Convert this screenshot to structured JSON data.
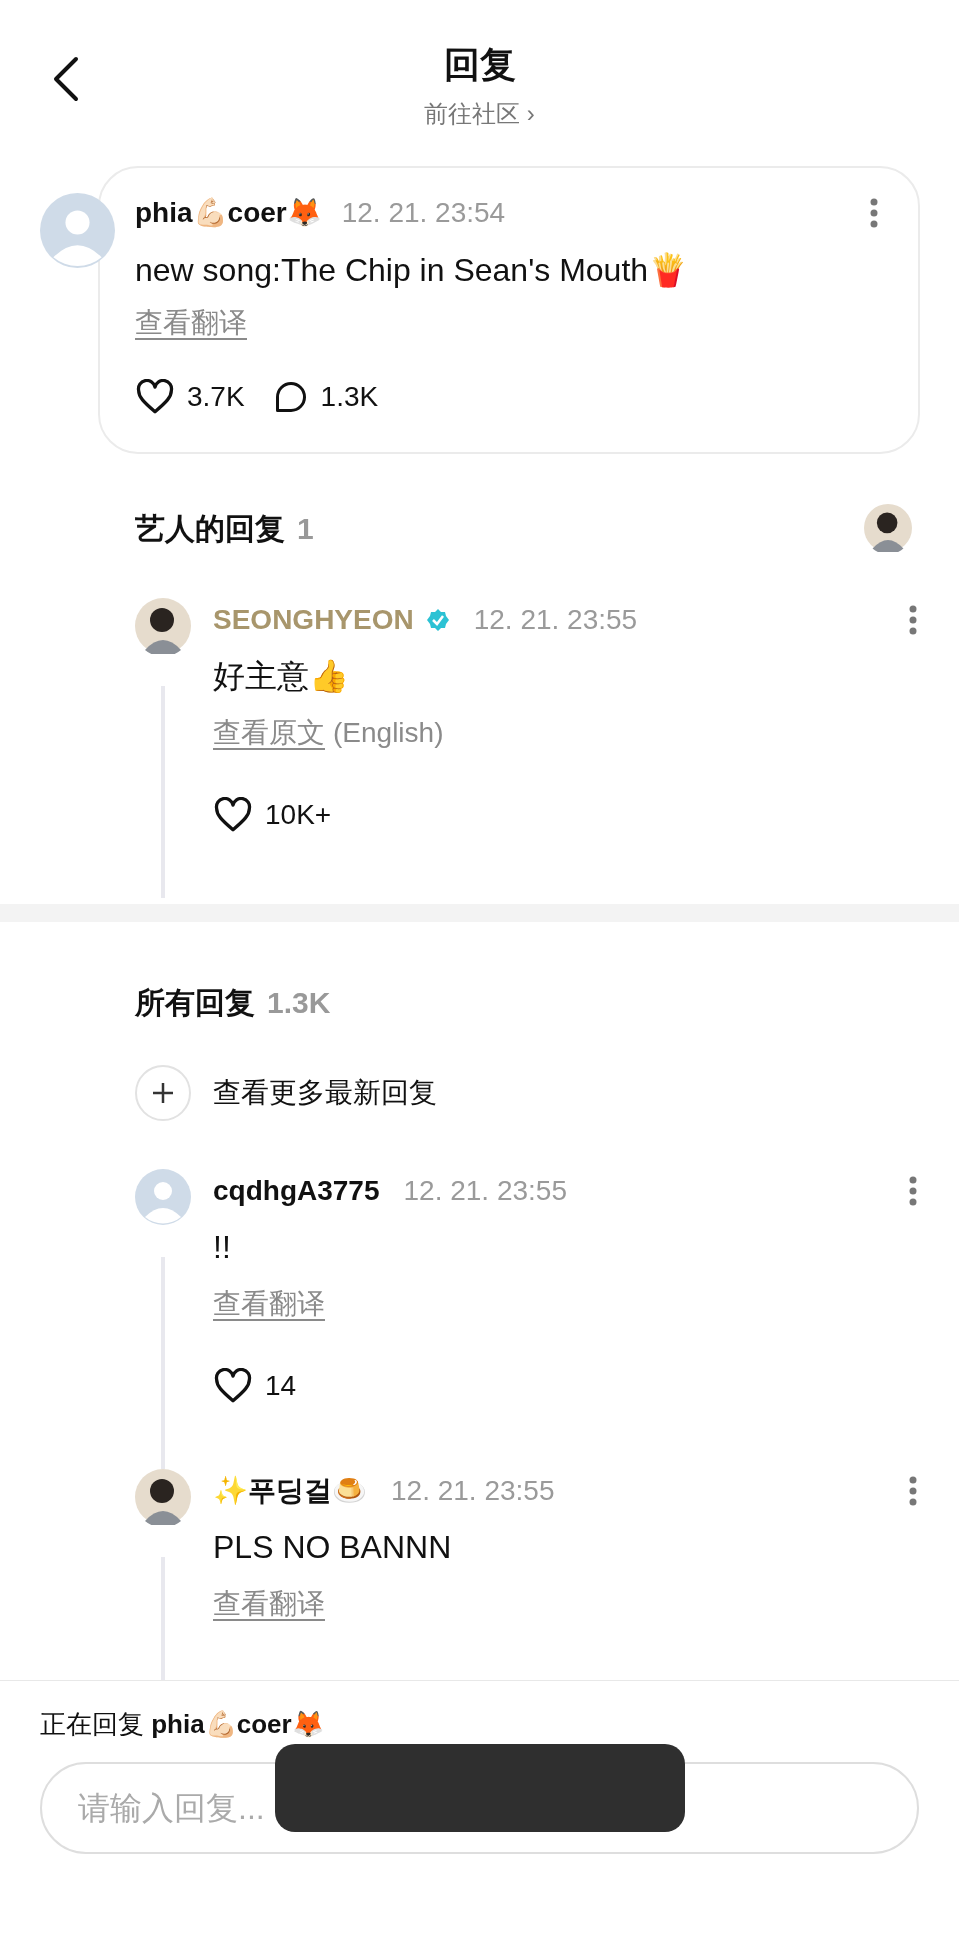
{
  "header": {
    "title": "回复",
    "subtitle": "前往社区",
    "subtitle_arrow": "›"
  },
  "post": {
    "avatar": {
      "kind": "default"
    },
    "name": "phia💪🏻coer🦊",
    "time": "12. 21. 23:54",
    "text": "new song:The Chip in Sean's Mouth🍟",
    "translate": "查看翻译",
    "likes": "3.7K",
    "replies": "1.3K"
  },
  "artist_section": {
    "title": "艺人的回复",
    "count": "1",
    "comments": [
      {
        "avatar": {
          "kind": "photo"
        },
        "name": "SEONGHYEON",
        "verified": true,
        "artist": true,
        "time": "12. 21. 23:55",
        "text": "好主意👍",
        "translate": "查看原文",
        "translate_note": "(English)",
        "likes": "10K+"
      }
    ]
  },
  "all_section": {
    "title": "所有回复",
    "count": "1.3K",
    "more": "查看更多最新回复",
    "comments": [
      {
        "avatar": {
          "kind": "default"
        },
        "name": "cqdhgA3775",
        "verified": false,
        "artist": false,
        "time": "12. 21. 23:55",
        "text": "!!",
        "translate": "查看翻译",
        "likes": "14"
      },
      {
        "avatar": {
          "kind": "photo"
        },
        "name": "✨푸딩걸🍮",
        "verified": false,
        "artist": false,
        "time": "12. 21. 23:55",
        "text": "PLS NO BANNN",
        "translate": "查看翻译"
      }
    ]
  },
  "composer": {
    "replying_label": "正在回复",
    "replying_to": "phia💪🏻coer🦊",
    "placeholder": "请输入回复..."
  },
  "toast": {
    "kind": "blurred"
  }
}
